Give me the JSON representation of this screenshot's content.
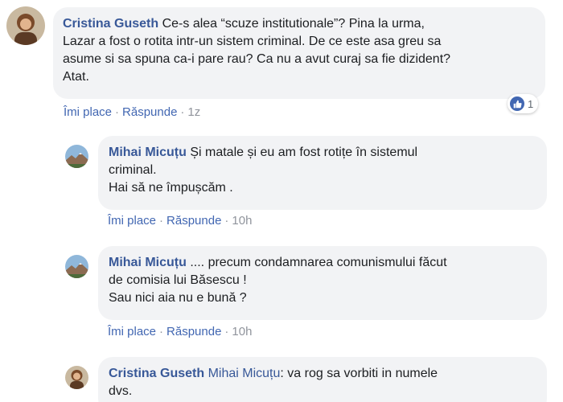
{
  "comments": [
    {
      "author": "Cristina Guseth",
      "text_line1": " Ce-s alea “scuze institutionale”? Pina la urma,",
      "text_line2": "Lazar a fost o rotita intr-un sistem criminal. De ce este asa greu sa",
      "text_line3": "asume si sa spuna ca-i pare rau? Ca nu a avut curaj sa fie dizident?",
      "text_line4": "Atat.",
      "like_label": "Îmi place",
      "reply_label": "Răspunde",
      "time": "1z",
      "reaction_count": "1",
      "reaction_icon": "like-icon"
    },
    {
      "author": "Mihai Micuțu",
      "text_line1": " Și matale și eu am fost rotițe în sistemul",
      "text_line2": "criminal.",
      "text_line3": "Hai să ne împușcăm .",
      "like_label": "Îmi place",
      "reply_label": "Răspunde",
      "time": "10h"
    },
    {
      "author": "Mihai Micuțu",
      "text_line1": " .... precum condamnarea comunismului făcut",
      "text_line2": "de comisia lui Băsescu !",
      "text_line3": "Sau nici aia nu e bună ?",
      "like_label": "Îmi place",
      "reply_label": "Răspunde",
      "time": "10h"
    },
    {
      "author": "Cristina Guseth",
      "mention": " Mihai Micuțu",
      "text_line1": ": va rog sa vorbiti in numele",
      "text_line2": "dvs."
    }
  ],
  "separator": "·",
  "colors": {
    "link": "#385898",
    "action": "#4267b2",
    "bubble": "#f2f3f5",
    "meta": "#90949c"
  }
}
